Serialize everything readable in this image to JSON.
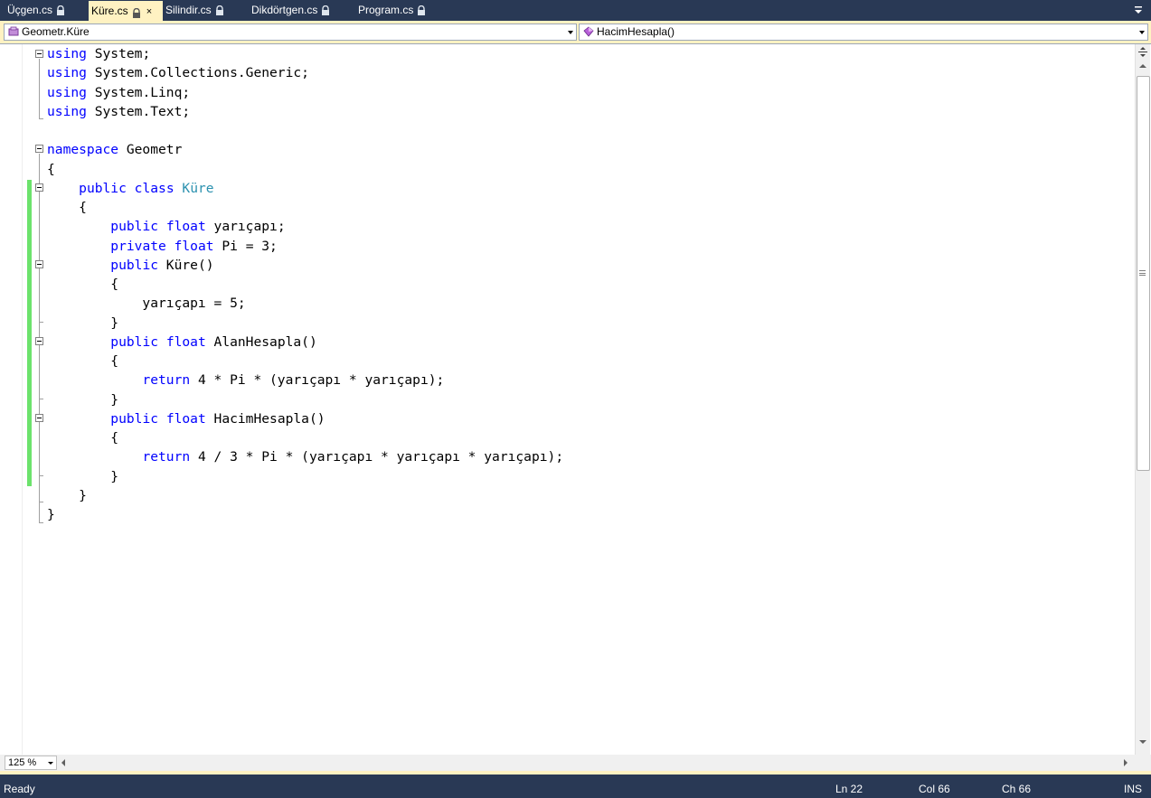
{
  "tabs": [
    {
      "label": "Üçgen.cs",
      "active": false
    },
    {
      "label": "Küre.cs",
      "active": true
    },
    {
      "label": "Silindir.cs",
      "active": false
    },
    {
      "label": "Dikdörtgen.cs",
      "active": false
    },
    {
      "label": "Program.cs",
      "active": false
    }
  ],
  "navbar": {
    "class_selector": "Geometr.Küre",
    "member_selector": "HacimHesapla()"
  },
  "editor": {
    "lines": [
      [
        [
          "kw",
          "using"
        ],
        [
          "t",
          " System;"
        ]
      ],
      [
        [
          "kw",
          "using"
        ],
        [
          "t",
          " System.Collections.Generic;"
        ]
      ],
      [
        [
          "kw",
          "using"
        ],
        [
          "t",
          " System.Linq;"
        ]
      ],
      [
        [
          "kw",
          "using"
        ],
        [
          "t",
          " System.Text;"
        ]
      ],
      [],
      [
        [
          "kw",
          "namespace"
        ],
        [
          "t",
          " Geometr"
        ]
      ],
      [
        [
          "t",
          "{"
        ]
      ],
      [
        [
          "t",
          "    "
        ],
        [
          "kw",
          "public"
        ],
        [
          "t",
          " "
        ],
        [
          "kw",
          "class"
        ],
        [
          "t",
          " "
        ],
        [
          "type",
          "Küre"
        ]
      ],
      [
        [
          "t",
          "    {"
        ]
      ],
      [
        [
          "t",
          "        "
        ],
        [
          "kw",
          "public"
        ],
        [
          "t",
          " "
        ],
        [
          "kw",
          "float"
        ],
        [
          "t",
          " yarıçapı;"
        ]
      ],
      [
        [
          "t",
          "        "
        ],
        [
          "kw",
          "private"
        ],
        [
          "t",
          " "
        ],
        [
          "kw",
          "float"
        ],
        [
          "t",
          " Pi = 3;"
        ]
      ],
      [
        [
          "t",
          "        "
        ],
        [
          "kw",
          "public"
        ],
        [
          "t",
          " Küre()"
        ]
      ],
      [
        [
          "t",
          "        {"
        ]
      ],
      [
        [
          "t",
          "            yarıçapı = 5;"
        ]
      ],
      [
        [
          "t",
          "        }"
        ]
      ],
      [
        [
          "t",
          "        "
        ],
        [
          "kw",
          "public"
        ],
        [
          "t",
          " "
        ],
        [
          "kw",
          "float"
        ],
        [
          "t",
          " AlanHesapla()"
        ]
      ],
      [
        [
          "t",
          "        {"
        ]
      ],
      [
        [
          "t",
          "            "
        ],
        [
          "kw",
          "return"
        ],
        [
          "t",
          " 4 * Pi * (yarıçapı * yarıçapı);"
        ]
      ],
      [
        [
          "t",
          "        }"
        ]
      ],
      [
        [
          "t",
          "        "
        ],
        [
          "kw",
          "public"
        ],
        [
          "t",
          " "
        ],
        [
          "kw",
          "float"
        ],
        [
          "t",
          " HacimHesapla()"
        ]
      ],
      [
        [
          "t",
          "        {"
        ]
      ],
      [
        [
          "t",
          "            "
        ],
        [
          "kw",
          "return"
        ],
        [
          "t",
          " 4 / 3 * Pi * (yarıçapı * yarıçapı * yarıçapı);"
        ]
      ],
      [
        [
          "t",
          "        }"
        ]
      ],
      [
        [
          "t",
          "    }"
        ]
      ],
      [
        [
          "t",
          "}"
        ]
      ]
    ]
  },
  "zoom": {
    "value": "125 %"
  },
  "status": {
    "state": "Ready",
    "line": "Ln 22",
    "column": "Col 66",
    "char": "Ch 66",
    "mode": "INS"
  },
  "colors": {
    "keyword": "#0000ff",
    "type": "#2b91af",
    "chrome": "#293955",
    "active_tab": "#fff2c2",
    "change_bar": "#6ce26c"
  },
  "icons": {
    "tab_lock": "lock-icon",
    "member_selector": "method-icon"
  }
}
